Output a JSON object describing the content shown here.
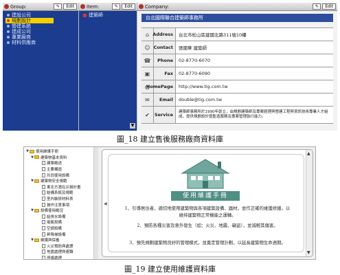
{
  "figure18": {
    "group_pane": {
      "header_label": "Group:",
      "edit_label": "Edit",
      "items": [
        {
          "label": "建設公司",
          "selected": false
        },
        {
          "label": "規劃設計",
          "selected": true
        },
        {
          "label": "營建系統",
          "selected": false
        },
        {
          "label": "建成公司",
          "selected": false
        },
        {
          "label": "專業廠商",
          "selected": false
        },
        {
          "label": "材料供應商",
          "selected": false
        }
      ]
    },
    "item_pane": {
      "header_label": "Item:",
      "edit_label": "Edit",
      "items": [
        {
          "label": "建築師",
          "selected": false
        }
      ]
    },
    "company_pane": {
      "header_label": "Company:",
      "edit_label": "Edit",
      "title": "台北國際聯合建築師事務所",
      "fields": [
        {
          "icon": "house-icon",
          "label": "Address",
          "value": "台北市松山區建國北路311號10樓"
        },
        {
          "icon": "contact-icon",
          "label": "Contact",
          "value": "張國華 建築師"
        },
        {
          "icon": "phone-icon",
          "label": "Phone",
          "value": "02-8770-6070"
        },
        {
          "icon": "fax-icon",
          "label": "Fax",
          "value": "02-8770-6090"
        },
        {
          "icon": "globe-icon",
          "label": "HomePage",
          "value": "http://www.tig.com.tw"
        },
        {
          "icon": "email-icon",
          "label": "Email",
          "value": "double@tig.com.tw"
        },
        {
          "icon": "service-icon",
          "label": "Service",
          "value": "建築師事務所於1990年創立，由規劃建築師及專案經理與營建工程與資訊技術專業人才組成，提供規劃設計暨監造服務及專案管理執行能力。"
        }
      ]
    },
    "caption": "圖_18  建立售後服務廠商資料庫"
  },
  "figure19": {
    "tree": [
      {
        "level": 0,
        "type": "folder",
        "label": "使用維護手冊"
      },
      {
        "level": 1,
        "type": "folder",
        "label": "建築物基本資料"
      },
      {
        "level": 2,
        "type": "doc",
        "label": "建築概述"
      },
      {
        "level": 2,
        "type": "doc",
        "label": "主要構造"
      },
      {
        "level": 2,
        "type": "doc",
        "label": "共同使用設備"
      },
      {
        "level": 1,
        "type": "folder",
        "label": "建築物安全規範"
      },
      {
        "level": 2,
        "type": "doc",
        "label": "東北方潛在災損計畫"
      },
      {
        "level": 2,
        "type": "doc",
        "label": "結構系統及規範"
      },
      {
        "level": 2,
        "type": "doc",
        "label": "室內裝修材料表"
      },
      {
        "level": 2,
        "type": "doc",
        "label": "施作注意事項"
      },
      {
        "level": 1,
        "type": "folder",
        "label": "設備使用概況"
      },
      {
        "level": 2,
        "type": "doc",
        "label": "給排水設備"
      },
      {
        "level": 2,
        "type": "doc",
        "label": "電氣設備"
      },
      {
        "level": 2,
        "type": "doc",
        "label": "空調設備"
      },
      {
        "level": 2,
        "type": "doc",
        "label": "昇降梯設備"
      },
      {
        "level": 1,
        "type": "folder",
        "label": "維護與保養"
      },
      {
        "level": 2,
        "type": "doc",
        "label": "火災預防與處理"
      },
      {
        "level": 2,
        "type": "doc",
        "label": "地震處理與避難"
      },
      {
        "level": 2,
        "type": "doc",
        "label": "停電處理"
      },
      {
        "level": 2,
        "type": "doc",
        "label": "其他使用注意事項"
      }
    ],
    "handbook_title": "使用維護手冊",
    "paragraphs": [
      "1、引導居住者，適切地使用建築物與各項建築設備、器材，並作正確的維護修繕，以維持建築物正常機能之運轉。",
      "2、預防各種災害及意外發生（如：火災、地震、竊盜），並減輕其傷害。",
      "3、預先規劃建築物良好的管理模式，並奠定管理計劃，以延長建築物生命週期。"
    ],
    "caption": "圖_19  建立使用維護資料庫"
  },
  "colors": {
    "pane_blue": "#1b3c8f",
    "selected_yellow": "#f5d000",
    "title_blue": "#2d4d9e",
    "handbook_teal": "#4f8f84"
  }
}
